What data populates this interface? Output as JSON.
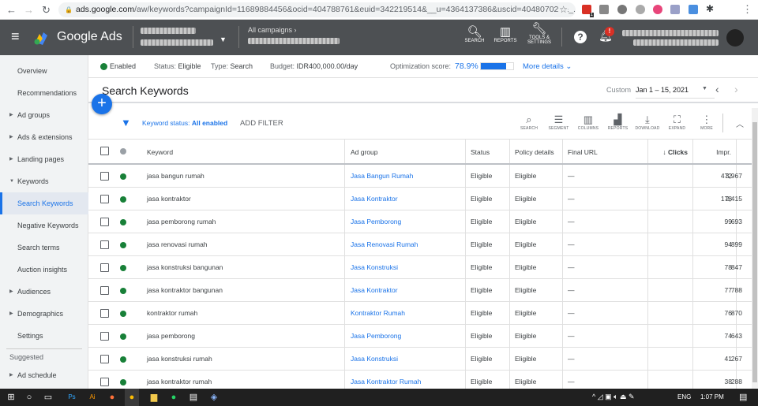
{
  "browser": {
    "url_host": "ads.google.com",
    "url_path": "/aw/keywords?campaignId=11689884456&ocid=404788761&euid=342219514&__u=4364137386&uscid=404807029&_...",
    "ext_badge": "1"
  },
  "header": {
    "brand": "Google Ads",
    "campaigns_label": "All campaigns",
    "icons": {
      "search": "SEARCH",
      "reports": "REPORTS",
      "tools1": "TOOLS &",
      "tools2": "SETTINGS"
    },
    "alert_badge": "!"
  },
  "status": {
    "enabled": "Enabled",
    "status_label": "Status:",
    "status_value": "Eligible",
    "type_label": "Type:",
    "type_value": "Search",
    "budget_label": "Budget:",
    "budget_value": "IDR400,000.00/day",
    "opt_label": "Optimization score:",
    "opt_value": "78.9%",
    "opt_fraction": 0.789,
    "more_details": "More details"
  },
  "sidebar": {
    "items": [
      {
        "label": "Overview"
      },
      {
        "label": "Recommendations"
      },
      {
        "label": "Ad groups",
        "arrow": true
      },
      {
        "label": "Ads & extensions",
        "arrow": true
      },
      {
        "label": "Landing pages",
        "arrow": true
      },
      {
        "label": "Keywords",
        "arrow": true,
        "open": true
      },
      {
        "label": "Search Keywords",
        "selected": true
      },
      {
        "label": "Negative Keywords"
      },
      {
        "label": "Search terms"
      },
      {
        "label": "Auction insights"
      },
      {
        "label": "Audiences",
        "arrow": true
      },
      {
        "label": "Demographics",
        "arrow": true
      },
      {
        "label": "Settings"
      }
    ],
    "suggested": "Suggested",
    "ad_schedule": "Ad schedule"
  },
  "page": {
    "title": "Search Keywords",
    "date_mode": "Custom",
    "date_range": "Jan 1 – 15, 2021"
  },
  "toolbar": {
    "filter_label": "Keyword status:",
    "filter_value": "All enabled",
    "add_filter": "ADD FILTER",
    "tools": [
      "SEARCH",
      "SEGMENT",
      "COLUMNS",
      "REPORTS",
      "DOWNLOAD",
      "EXPAND",
      "MORE"
    ]
  },
  "table": {
    "headers": {
      "keyword": "Keyword",
      "ad_group": "Ad group",
      "status": "Status",
      "policy": "Policy details",
      "final_url": "Final URL",
      "clicks": "Clicks",
      "impr": "Impr."
    },
    "rows": [
      {
        "keyword": "jasa bangun rumah",
        "ad_group": "Jasa Bangun Rumah",
        "status": "Eligible",
        "policy": "Eligible",
        "final_url": "—",
        "clicks": "472",
        "impr": "3,967"
      },
      {
        "keyword": "jasa kontraktor",
        "ad_group": "Jasa Kontraktor",
        "status": "Eligible",
        "policy": "Eligible",
        "final_url": "—",
        "clicks": "178",
        "impr": "2,415"
      },
      {
        "keyword": "jasa pemborong rumah",
        "ad_group": "Jasa Pemborong",
        "status": "Eligible",
        "policy": "Eligible",
        "final_url": "—",
        "clicks": "99",
        "impr": "693"
      },
      {
        "keyword": "jasa renovasi rumah",
        "ad_group": "Jasa Renovasi Rumah",
        "status": "Eligible",
        "policy": "Eligible",
        "final_url": "—",
        "clicks": "94",
        "impr": "899"
      },
      {
        "keyword": "jasa konstruksi bangunan",
        "ad_group": "Jasa Konstruksi",
        "status": "Eligible",
        "policy": "Eligible",
        "final_url": "—",
        "clicks": "78",
        "impr": "847"
      },
      {
        "keyword": "jasa kontraktor bangunan",
        "ad_group": "Jasa Kontraktor",
        "status": "Eligible",
        "policy": "Eligible",
        "final_url": "—",
        "clicks": "77",
        "impr": "788"
      },
      {
        "keyword": "kontraktor rumah",
        "ad_group": "Kontraktor Rumah",
        "status": "Eligible",
        "policy": "Eligible",
        "final_url": "—",
        "clicks": "76",
        "impr": "870"
      },
      {
        "keyword": "jasa pemborong",
        "ad_group": "Jasa Pemborong",
        "status": "Eligible",
        "policy": "Eligible",
        "final_url": "—",
        "clicks": "74",
        "impr": "643"
      },
      {
        "keyword": "jasa konstruksi rumah",
        "ad_group": "Jasa Konstruksi",
        "status": "Eligible",
        "policy": "Eligible",
        "final_url": "—",
        "clicks": "41",
        "impr": "267"
      },
      {
        "keyword": "jasa kontraktor rumah",
        "ad_group": "Jasa Kontraktor Rumah",
        "status": "Eligible",
        "policy": "Eligible",
        "final_url": "—",
        "clicks": "38",
        "impr": "288"
      }
    ]
  },
  "taskbar": {
    "lang": "ENG",
    "time": "1:07 PM"
  },
  "colors": {
    "accent": "#1a73e8",
    "header_bg": "#4d5053",
    "enabled_green": "#188038"
  }
}
